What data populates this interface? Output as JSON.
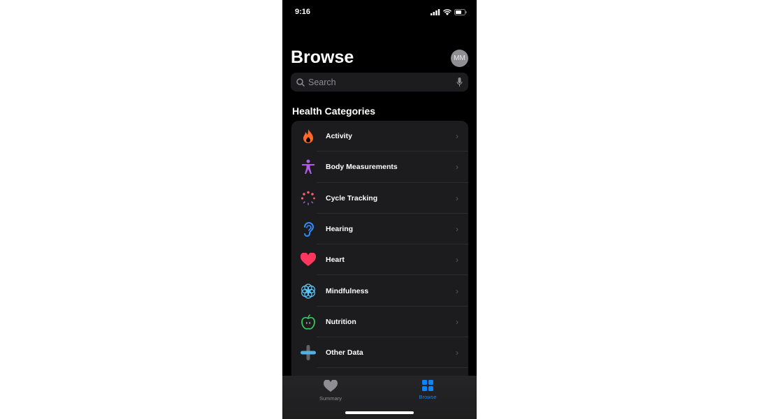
{
  "status": {
    "time": "9:16"
  },
  "header": {
    "title": "Browse",
    "avatar_initials": "MM"
  },
  "search": {
    "placeholder": "Search"
  },
  "section_title": "Health Categories",
  "categories": [
    {
      "label": "Activity",
      "icon": "flame-icon",
      "color": "#ff6a2b"
    },
    {
      "label": "Body Measurements",
      "icon": "person-icon",
      "color": "#b05ce6"
    },
    {
      "label": "Cycle Tracking",
      "icon": "cycle-icon",
      "color": "#ff5a6e"
    },
    {
      "label": "Hearing",
      "icon": "ear-icon",
      "color": "#2f8cff"
    },
    {
      "label": "Heart",
      "icon": "heart-icon",
      "color": "#ff375f"
    },
    {
      "label": "Mindfulness",
      "icon": "flower-icon",
      "color": "#5ac8fa"
    },
    {
      "label": "Nutrition",
      "icon": "apple-icon",
      "color": "#34c759"
    },
    {
      "label": "Other Data",
      "icon": "plus-icon",
      "color": "#4fb0e8"
    }
  ],
  "tabs": [
    {
      "label": "Summary",
      "active": false
    },
    {
      "label": "Browse",
      "active": true
    }
  ],
  "colors": {
    "accent": "#0a84ff",
    "inactive": "#8e8e93"
  }
}
